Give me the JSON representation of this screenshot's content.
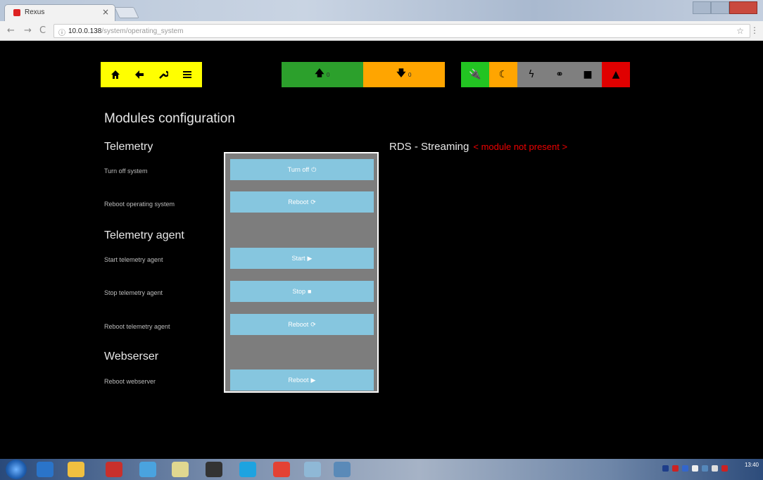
{
  "browser": {
    "tab_title": "Rexus",
    "tab_close": "×",
    "nav_back": "←",
    "nav_forward": "→",
    "nav_reload": "C",
    "url_host": "10.0.0.138",
    "url_path": "/system/operating_system",
    "bookmark_star": "☆",
    "menu": "⋮"
  },
  "toolbar": {
    "home_icon": "home-icon",
    "back_icon": "arrow-left-icon",
    "settings_icon": "wrench-icon",
    "menu_icon": "hamburger-icon",
    "upload_count": "0",
    "download_count": "0",
    "colors": {
      "yellow": "#ffff00",
      "green": "#2ca02c",
      "orange": "#ffa500",
      "gray": "#808080",
      "red": "#e00000"
    }
  },
  "status_indicators": [
    {
      "name": "plug-icon",
      "glyph": "🔌",
      "color": "#22c422"
    },
    {
      "name": "moon-icon",
      "glyph": "☾",
      "color": "#ffa500"
    },
    {
      "name": "bolt-icon",
      "glyph": "ϟ",
      "color": "#7f7f7f"
    },
    {
      "name": "link-icon",
      "glyph": "⚭",
      "color": "#7f7f7f"
    },
    {
      "name": "lock-icon",
      "glyph": "■",
      "color": "#7f7f7f"
    },
    {
      "name": "warning-icon",
      "glyph": "▲",
      "color": "#e00000"
    }
  ],
  "main": {
    "title": "Modules configuration",
    "sections": {
      "telemetry": {
        "title": "Telemetry",
        "turn_off_label": "Turn off system",
        "turn_off_button": "Turn off",
        "reboot_os_label": "Reboot operating system",
        "reboot_os_button": "Reboot"
      },
      "telemetry_agent": {
        "title": "Telemetry agent",
        "start_label": "Start telemetry agent",
        "start_button": "Start",
        "stop_label": "Stop telemetry agent",
        "stop_button": "Stop",
        "reboot_label": "Reboot telemetry agent",
        "reboot_button": "Reboot"
      },
      "webserver": {
        "title": "Webserser",
        "reboot_label": "Reboot webserver",
        "reboot_button": "Reboot"
      }
    },
    "rds": {
      "title": "RDS - Streaming",
      "status": "< module not present >"
    }
  },
  "taskbar": {
    "clock_time": "13:40"
  }
}
